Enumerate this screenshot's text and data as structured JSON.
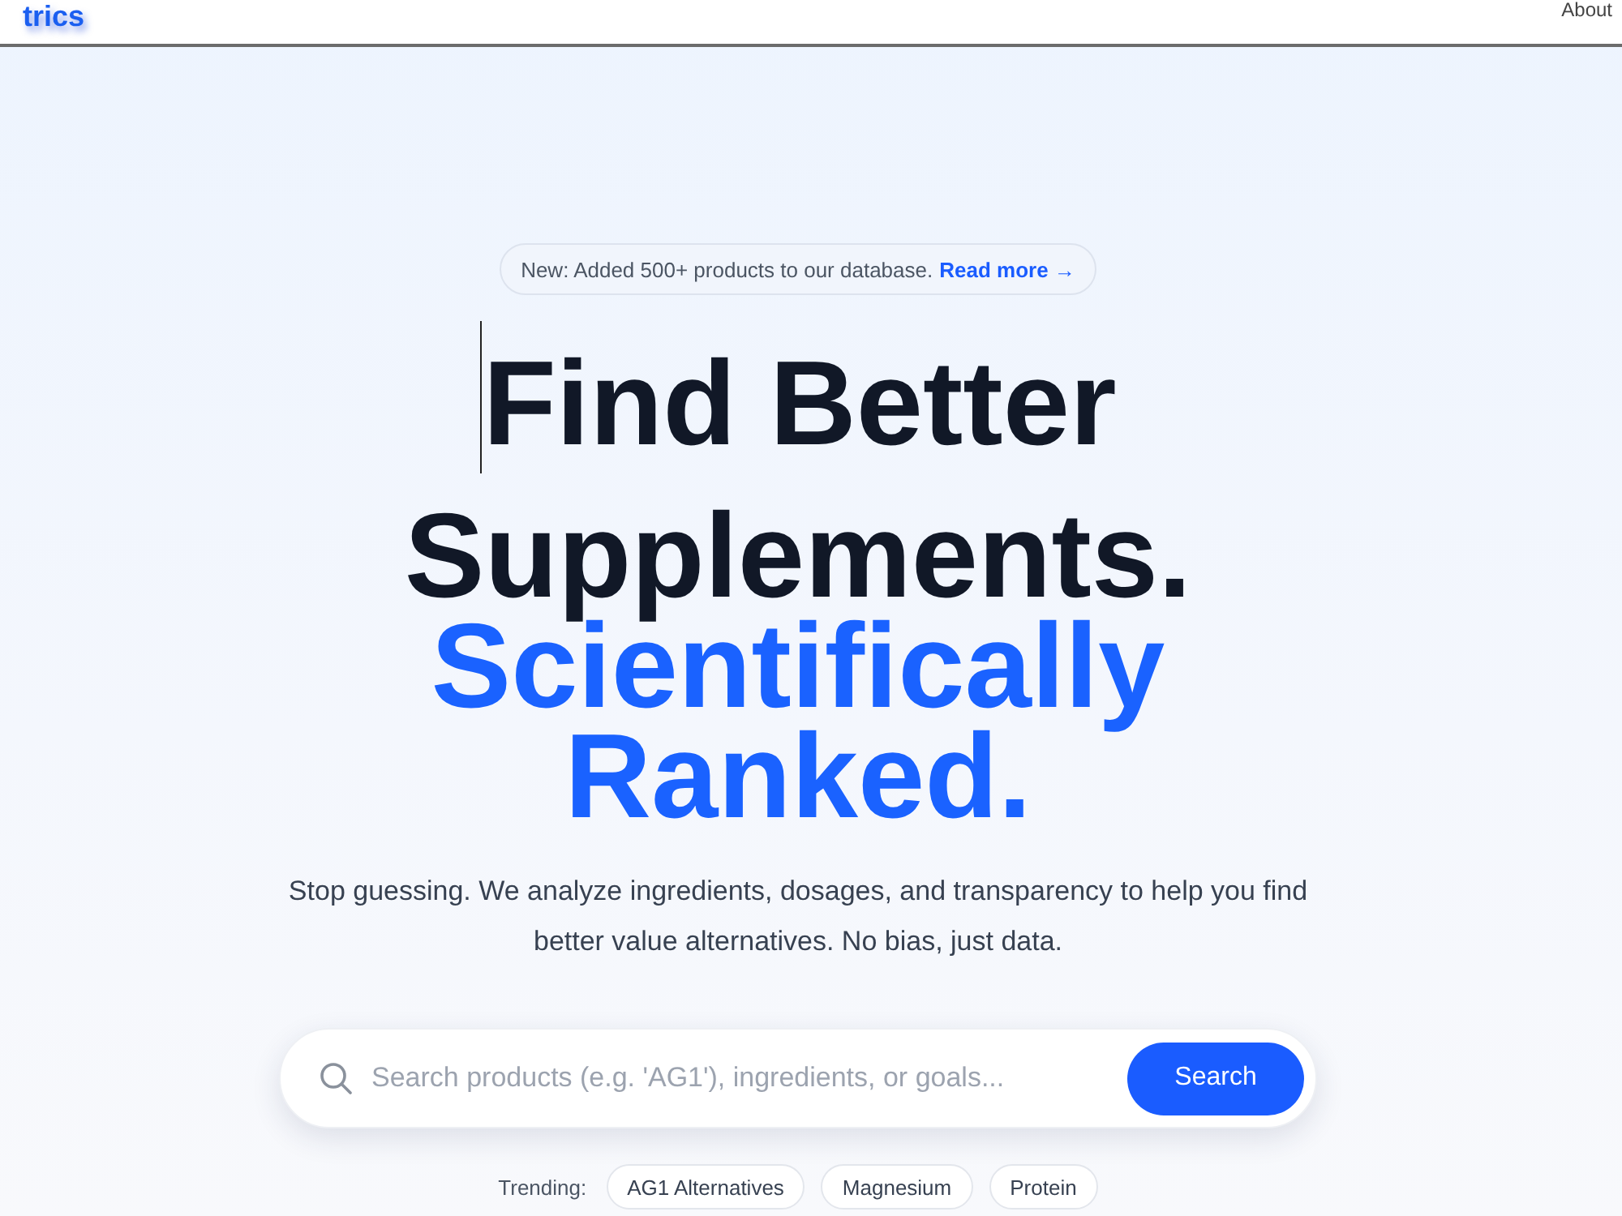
{
  "header": {
    "logo": "trics",
    "nav": [
      {
        "label": "About"
      }
    ]
  },
  "announcement": {
    "text": "New: Added 500+ products to our database.",
    "link": "Read more →"
  },
  "hero": {
    "title_lines": [
      {
        "text": "Find Better",
        "kind": "plain"
      },
      {
        "text": "Supplements.",
        "kind": "plain"
      },
      {
        "text": "Scientifically",
        "kind": "accent"
      },
      {
        "text": "Ranked.",
        "kind": "accent"
      }
    ],
    "subtitle": "Stop guessing. We analyze ingredients, dosages, and transparency to help you find better value alternatives. No bias, just data."
  },
  "search": {
    "placeholder": "Search products (e.g. 'AG1'), ingredients, or goals...",
    "button": "Search"
  },
  "trending": {
    "label": "Trending:",
    "tags": [
      "AG1 Alternatives",
      "Magnesium",
      "Protein"
    ]
  }
}
